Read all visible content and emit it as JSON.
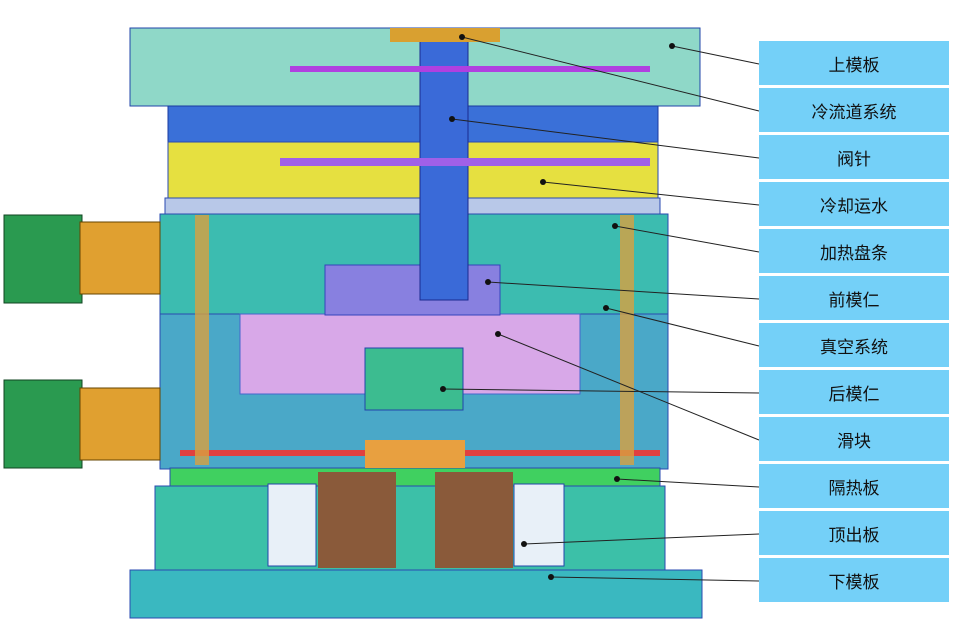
{
  "title": "模具结构示意图",
  "labels": [
    "上模板",
    "冷流道系统",
    "阀针",
    "冷却运水",
    "加热盘条",
    "前模仁",
    "真空系统",
    "后模仁",
    "滑块",
    "隔热板",
    "顶出板",
    "下模板"
  ],
  "colors": {
    "label_bg": "#74d0f8",
    "plate_teal": "#3cc0b0",
    "plate_blue": "#2a5ed8",
    "yellow": "#e8e040",
    "orange": "#d9a030",
    "pink": "#d8a8e8",
    "brown": "#8a5a3a",
    "green": "#2a9a50"
  }
}
